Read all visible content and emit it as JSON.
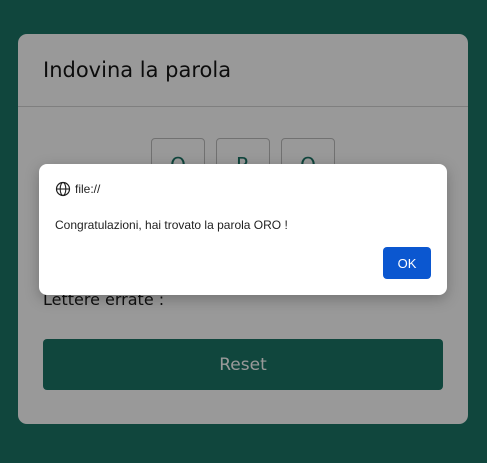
{
  "game": {
    "title": "Indovina la parola",
    "tiles": [
      "O",
      "R",
      "O"
    ],
    "wrong_letters_label": "Lettere errate :",
    "reset_label": "Reset"
  },
  "dialog": {
    "origin": "file://",
    "message": "Congratulazioni, hai trovato la parola ORO !",
    "ok_label": "OK",
    "origin_icon": "globe-icon"
  },
  "colors": {
    "background": "#1c7567",
    "accent": "#1c7567",
    "dialog_button": "#0b57d0"
  }
}
